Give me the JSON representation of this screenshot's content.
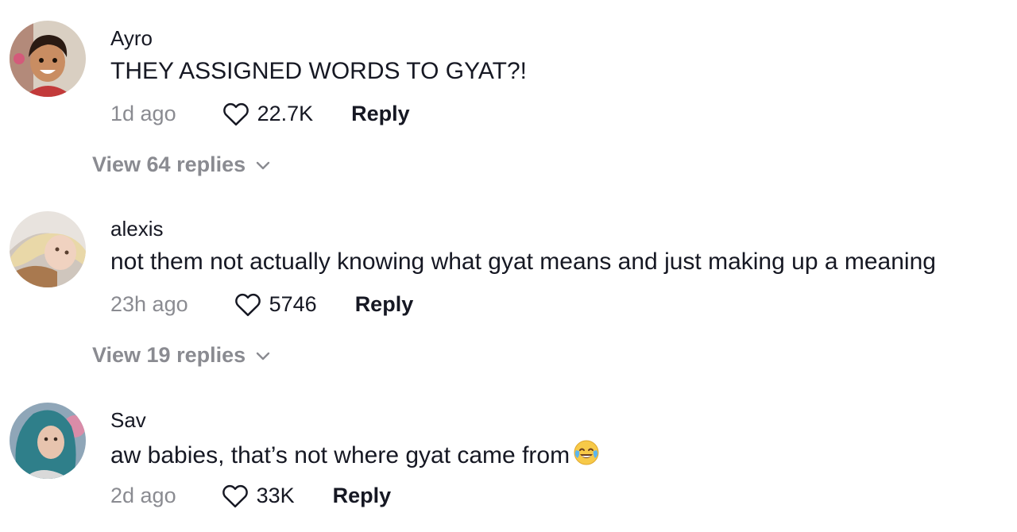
{
  "comments": [
    {
      "username": "Ayro",
      "text": "THEY ASSIGNED WORDS TO GYAT?!",
      "time": "1d ago",
      "likes": "22.7K",
      "reply_label": "Reply",
      "view_replies": "View 64 replies"
    },
    {
      "username": "alexis",
      "text": "not them not actually knowing what gyat means and just making up a meaning",
      "time": "23h ago",
      "likes": "5746",
      "reply_label": "Reply",
      "view_replies": "View 19 replies"
    },
    {
      "username": "Sav",
      "text": "aw babies, that’s not where gyat came from",
      "emoji": "face-with-tears-of-joy",
      "time": "2d ago",
      "likes": "33K",
      "reply_label": "Reply"
    }
  ],
  "icons": {
    "like": "heart-outline-icon",
    "expand": "chevron-down-icon"
  },
  "colors": {
    "primary_text": "#161823",
    "secondary_text": "#8a8b91",
    "background": "#ffffff"
  }
}
